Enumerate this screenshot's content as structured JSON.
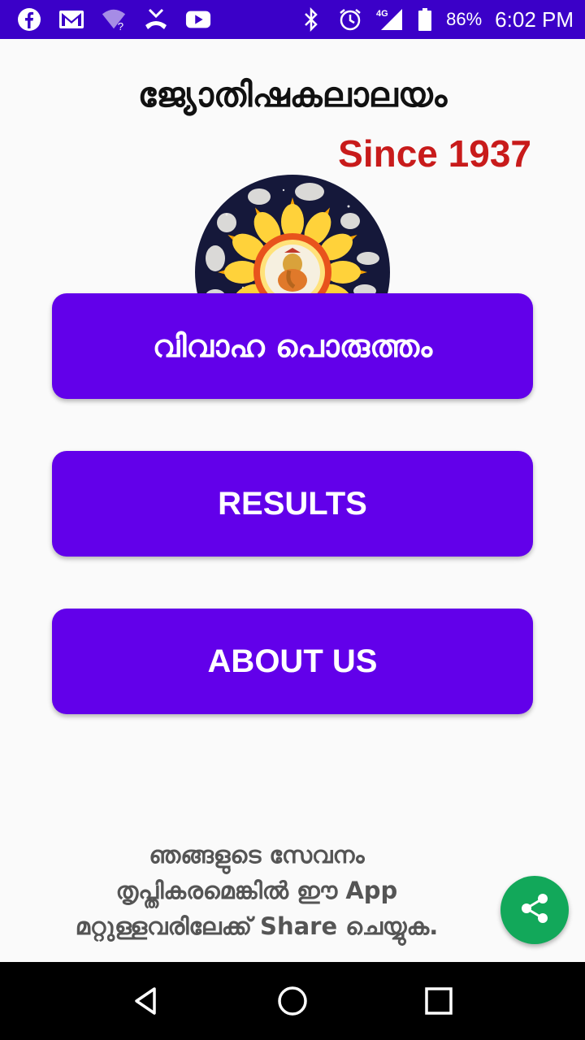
{
  "status_bar": {
    "left_icons": [
      "facebook-icon",
      "gmail-icon",
      "wifi-question-icon",
      "missed-call-icon",
      "youtube-icon"
    ],
    "right_icons": [
      "bluetooth-icon",
      "alarm-icon",
      "signal-4g-icon",
      "battery-icon"
    ],
    "network": "4G",
    "battery": "86%",
    "time": "6:02 PM",
    "background": "#3b00c8"
  },
  "header": {
    "title": "ജ്യോതിഷകലാലയം",
    "since": "Since 1937",
    "since_color": "#c81b1b"
  },
  "logo": {
    "icon": "zodiac-wheel-ganesha-logo"
  },
  "buttons": {
    "marriage_match": "വിവാഹ പൊരുത്തം",
    "results": "RESULTS",
    "about_us": "ABOUT US",
    "color": "#6200ea"
  },
  "footer": {
    "line1": "ഞങ്ങളുടെ സേവനം",
    "line2": "തൃപ്തികരമെങ്കിൽ ഈ App",
    "line3": "മറ്റുള്ളവരിലേക്ക് Share  ചെയ്യുക."
  },
  "share_fab": {
    "icon": "share-icon",
    "color": "#12a85a"
  },
  "nav_bar": {
    "icons": [
      "back-icon",
      "home-icon",
      "recents-icon"
    ]
  }
}
